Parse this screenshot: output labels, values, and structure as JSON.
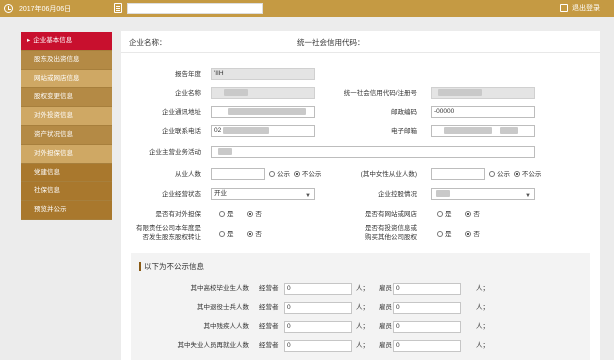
{
  "topbar": {
    "date": "2017年06月06日",
    "logout_label": "退出登录"
  },
  "sidebar": {
    "items": [
      {
        "label": "企业基本信息"
      },
      {
        "label": "股东及出资信息"
      },
      {
        "label": "网站或网店信息"
      },
      {
        "label": "股权变更信息"
      },
      {
        "label": "对外投资信息"
      },
      {
        "label": "资产状况信息"
      },
      {
        "label": "对外担保信息"
      },
      {
        "label": "党建信息"
      },
      {
        "label": "社保信息"
      },
      {
        "label": "预览并公示"
      }
    ]
  },
  "header": {
    "company_name_label": "企业名称：",
    "credit_code_label": "统一社会信用代码："
  },
  "form": {
    "report_year_label": "报告年度",
    "report_year_value": "'IIH",
    "company_name_label": "企业名称",
    "credit_code_label": "统一社会信用代码/注册号",
    "address_label": "企业通讯地址",
    "postcode_label": "邮政编码",
    "postcode_value": "-00000",
    "phone_label": "企业联系电话",
    "phone_value": "02",
    "email_label": "电子邮箱",
    "business_label": "企业主营业务活动",
    "employees_label": "从业人数",
    "public_label": "公示",
    "not_public_label": "不公示",
    "female_employees_label": "(其中女性从业人数)",
    "status_label": "企业经营状态",
    "status_value": "开业",
    "holding_label": "企业控股情况",
    "guarantee_q": "是否有对外担保",
    "website_q": "是否有网站或网店",
    "transfer_q_line1": "有限责任公司本年度是",
    "transfer_q_line2": "否发生股东股权转让",
    "invest_q_line1": "是否有投资信息或",
    "invest_q_line2": "购买其他公司股权",
    "yes_label": "是",
    "no_label": "否"
  },
  "lower": {
    "title": "以下为不公示信息",
    "rows": [
      {
        "label": "其中高校毕业生人数",
        "operator_label": "经营者",
        "operator_value": "0",
        "unit": "人；",
        "employee_label": "雇员",
        "employee_value": "0"
      },
      {
        "label": "其中退役士兵人数",
        "operator_label": "经营者",
        "operator_value": "0",
        "unit": "人；",
        "employee_label": "雇员",
        "employee_value": "0"
      },
      {
        "label": "其中残疾人人数",
        "operator_label": "经营者",
        "operator_value": "0",
        "unit": "人；",
        "employee_label": "雇员",
        "employee_value": "0"
      },
      {
        "label": "其中失业人员再就业人数",
        "operator_label": "经营者",
        "operator_value": "0",
        "unit": "人；",
        "employee_label": "雇员",
        "employee_value": "0"
      }
    ]
  },
  "colors": {
    "topbar": "#c59a43",
    "sidebar": "#b48a45",
    "active": "#c8102e"
  }
}
